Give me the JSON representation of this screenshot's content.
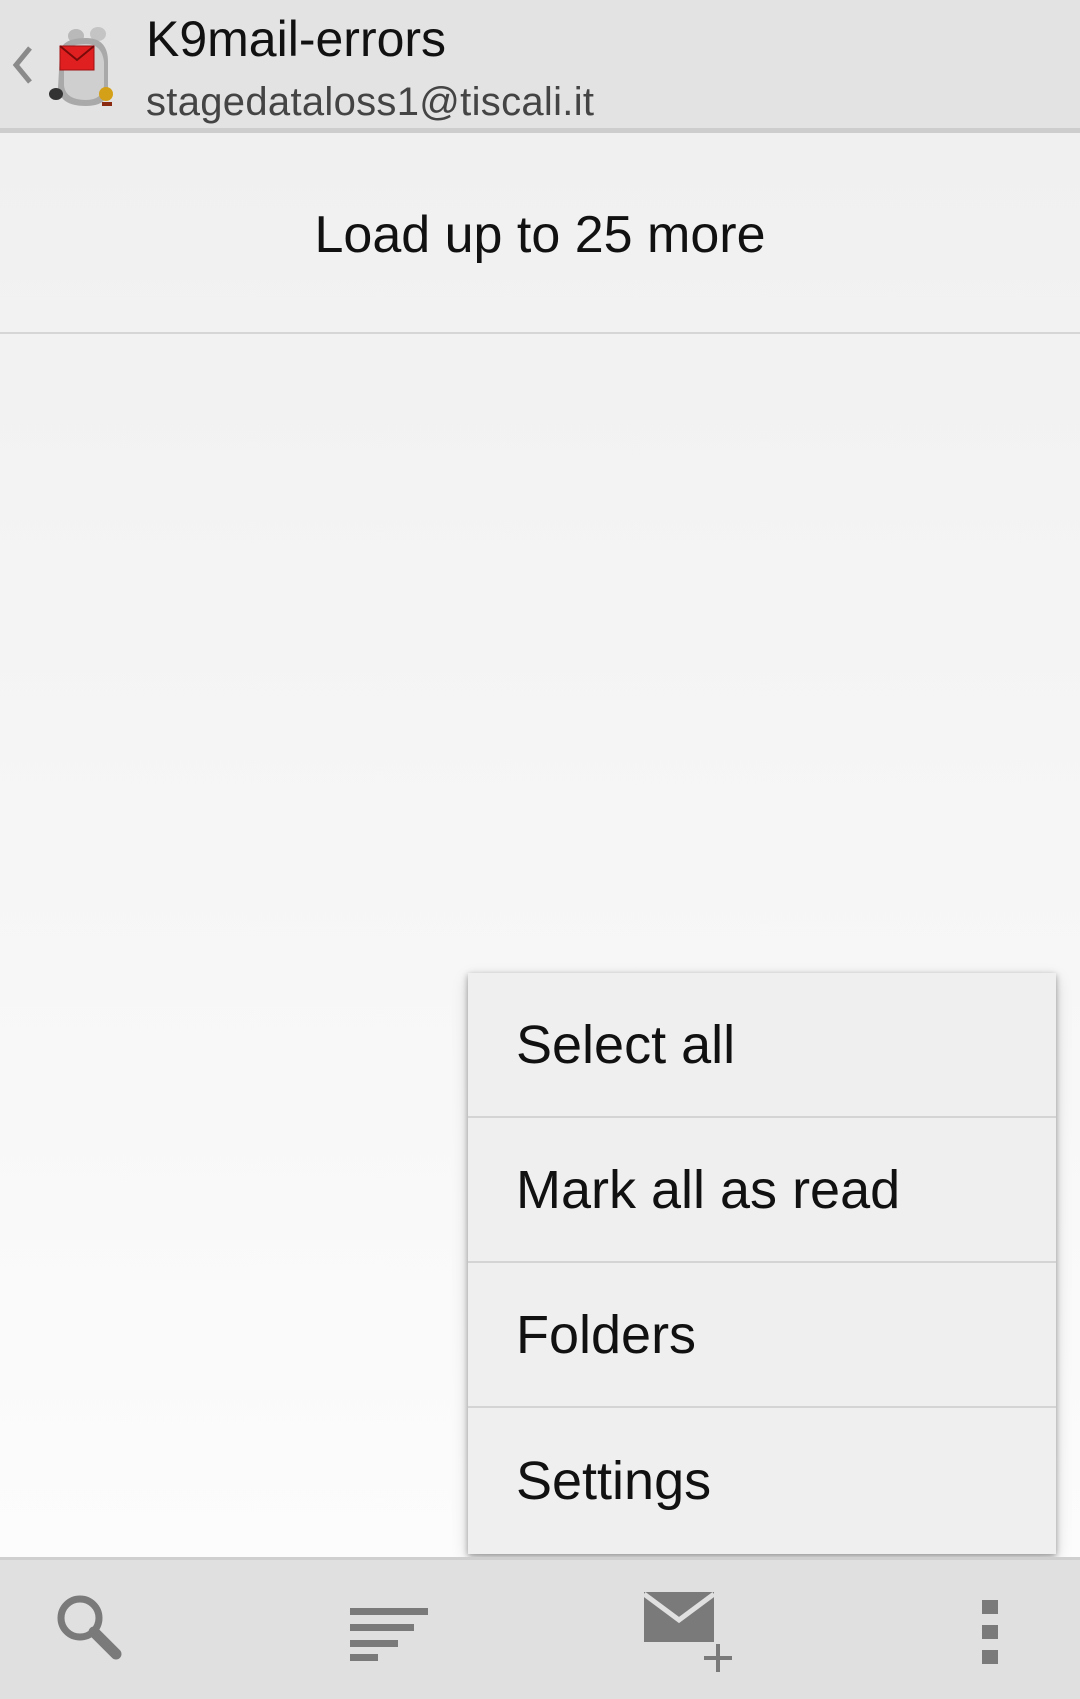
{
  "action_bar": {
    "title": "K9mail-errors",
    "subtitle": "stagedataloss1@tiscali.it",
    "up_icon": "chevron-left-icon",
    "app_icon": "k9-mail-dog-icon"
  },
  "message_list": {
    "load_more_label": "Load up to 25 more"
  },
  "overflow_menu": {
    "items": [
      {
        "label": "Select all"
      },
      {
        "label": "Mark all as read"
      },
      {
        "label": "Folders"
      },
      {
        "label": "Settings"
      }
    ]
  },
  "bottom_bar": {
    "icons": [
      "search-icon",
      "sort-icon",
      "compose-icon",
      "overflow-menu-icon"
    ]
  },
  "colors": {
    "action_bar_bg": "#e3e3e3",
    "menu_bg": "#efefef",
    "icon_gray": "#7a7a7a",
    "envelope_red": "#e02020"
  }
}
